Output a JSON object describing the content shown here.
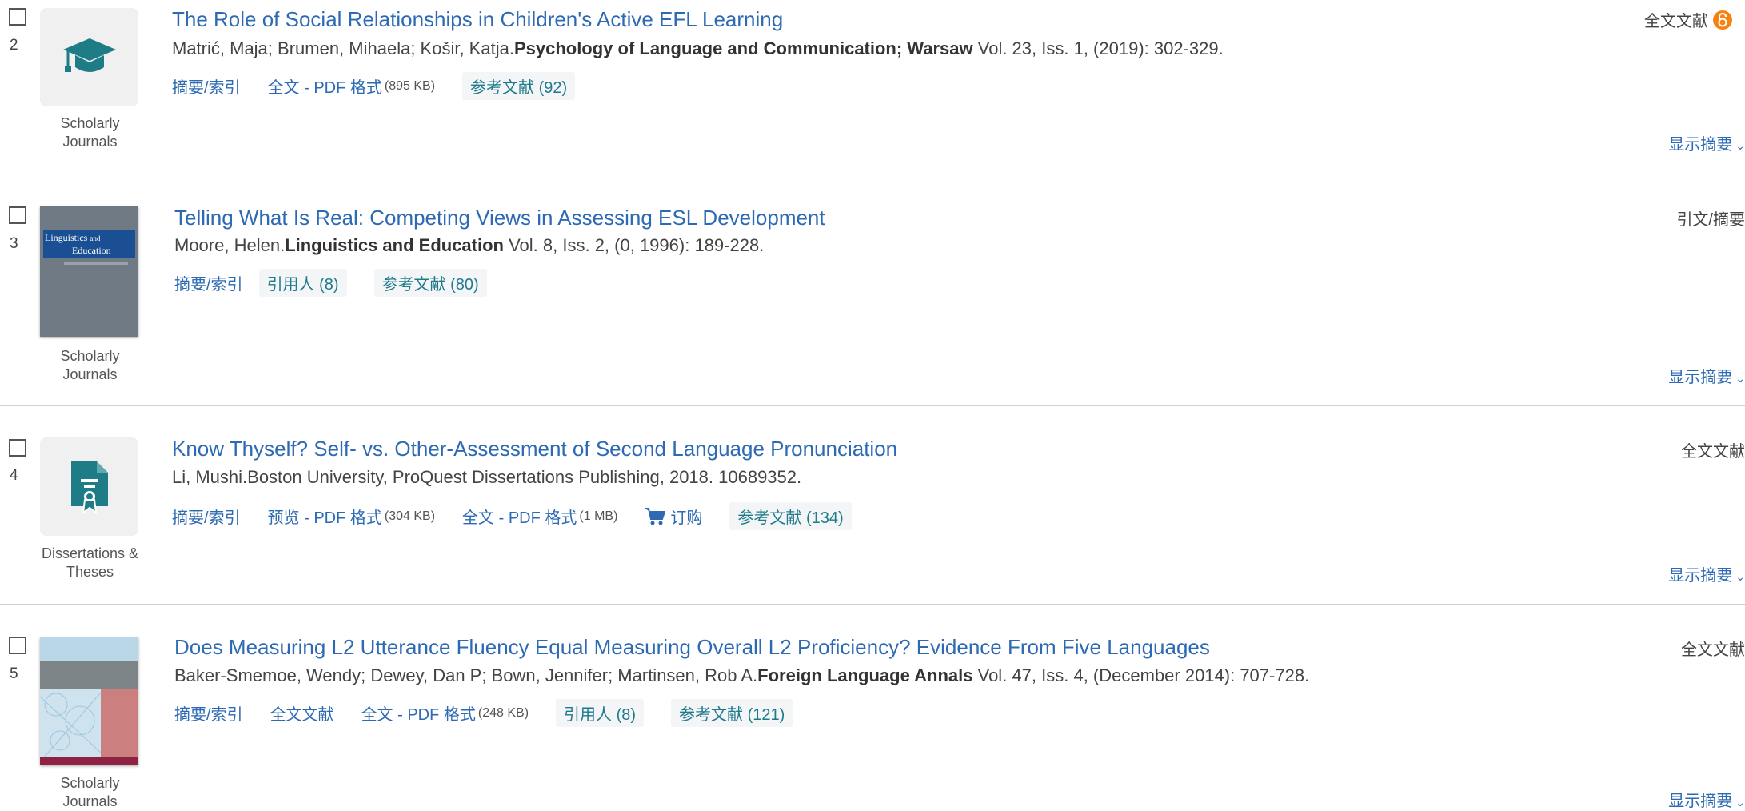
{
  "results": [
    {
      "number": "2",
      "title": "The Role of Social Relationships in Children's Active EFL Learning",
      "authors": "Matrić, Maja; Brumen, Mihaela; Košir, Katja.",
      "source": "Psychology of Language and Communication; Warsaw",
      "details": " Vol. 23, Iss. 1,  (2019): 302-329.",
      "type_label": [
        "Scholarly",
        "Journals"
      ],
      "icon": "graduation-cap-icon",
      "right_label": "全文文献",
      "links": {
        "abstract": "摘要/索引",
        "fulltext_pdf": "全文 - PDF 格式",
        "fulltext_pdf_size": "(895 KB)",
        "references": "参考文献 (92)"
      },
      "show_abstract": "显示摘要"
    },
    {
      "number": "3",
      "title": "Telling What Is Real: Competing Views in Assessing ESL Development",
      "authors": "Moore, Helen.",
      "source": "Linguistics and Education",
      "details": " Vol. 8, Iss. 2,  (0, 1996): 189-228.",
      "type_label": [
        "Scholarly",
        "Journals"
      ],
      "cover_title": [
        "Linguistics",
        "and",
        "Education"
      ],
      "right_label": "引文/摘要",
      "links": {
        "abstract": "摘要/索引",
        "cited_by": "引用人 (8)",
        "references": "参考文献 (80)"
      },
      "show_abstract": "显示摘要"
    },
    {
      "number": "4",
      "title": "Know Thyself? Self- vs. Other-Assessment of Second Language Pronunciation",
      "citation": "Li, Mushi.Boston University, ProQuest Dissertations Publishing, 2018. 10689352.",
      "type_label": [
        "Dissertations &",
        "Theses"
      ],
      "icon": "certificate-document-icon",
      "right_label": "全文文献",
      "links": {
        "abstract": "摘要/索引",
        "preview_pdf": "预览 - PDF 格式",
        "preview_pdf_size": "(304 KB)",
        "fulltext_pdf": "全文 - PDF 格式",
        "fulltext_pdf_size": "(1 MB)",
        "order": "订购",
        "references": "参考文献 (134)"
      },
      "show_abstract": "显示摘要"
    },
    {
      "number": "5",
      "title": "Does Measuring L2 Utterance Fluency Equal Measuring Overall L2 Proficiency? Evidence From Five Languages",
      "authors": "Baker-Smemoe, Wendy; Dewey, Dan P; Bown, Jennifer; Martinsen, Rob A.",
      "source": "Foreign Language Annals",
      "details": " Vol. 47, Iss. 4,  (December 2014): 707-728.",
      "type_label": [
        "Scholarly",
        "Journals"
      ],
      "right_label": "全文文献",
      "links": {
        "abstract": "摘要/索引",
        "fulltext": "全文文献",
        "fulltext_pdf": "全文 - PDF 格式",
        "fulltext_pdf_size": "(248 KB)",
        "cited_by": "引用人 (8)",
        "references": "参考文献 (121)"
      },
      "show_abstract": "显示摘要"
    }
  ],
  "colors": {
    "link": "#2d6ab3",
    "tag": "#1f7a8c",
    "open_access": "#f68212",
    "icon_teal": "#1e7c86"
  }
}
